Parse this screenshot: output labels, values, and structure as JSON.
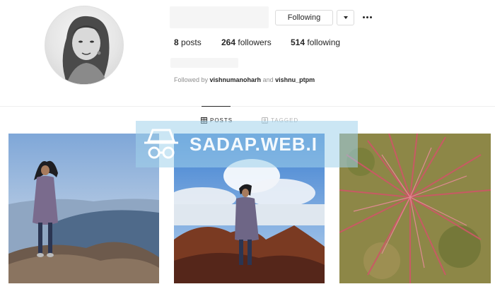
{
  "profile": {
    "username": "",
    "full_name": "",
    "following_button": "Following",
    "stats": [
      {
        "count": "8",
        "label": "posts"
      },
      {
        "count": "264",
        "label": "followers"
      },
      {
        "count": "514",
        "label": "following"
      }
    ],
    "followed_by": {
      "prefix": "Followed by",
      "user1": "vishnumanoharh",
      "joiner": "and",
      "user2": "vishnu_ptpm"
    }
  },
  "tabs": [
    {
      "label": "POSTS",
      "icon": "grid-icon",
      "active": true
    },
    {
      "label": "TAGGED",
      "icon": "tag-icon",
      "active": false
    }
  ],
  "watermark": {
    "text": "SADAP.WEB.I"
  },
  "posts": [
    {
      "subject": "woman standing on rock with mountain view"
    },
    {
      "subject": "woman sitting on rock under cloudy sky"
    },
    {
      "subject": "red spiky plant in grass"
    }
  ],
  "colors": {
    "text": "#262626",
    "muted": "#8e8e8e",
    "border": "#dbdbdb"
  }
}
